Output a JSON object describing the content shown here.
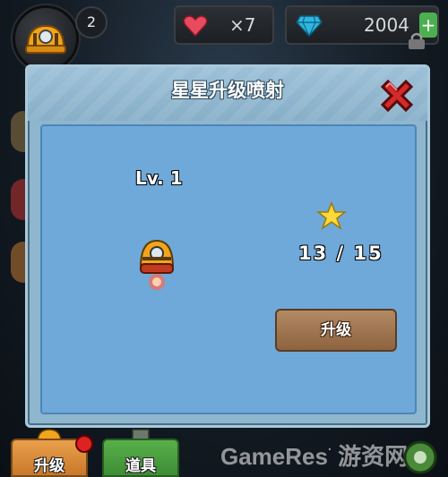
{
  "top_bar": {
    "level": "2",
    "lives": "×7",
    "gems": "2004",
    "plus": "+"
  },
  "modal": {
    "title": "星星升级喷射",
    "level_label": "Lv. 1",
    "star_progress": "13 / 15",
    "upgrade_button": "升级"
  },
  "bottom_tabs": {
    "upgrade": "升级",
    "items": "道具"
  },
  "watermark": "GameRes",
  "watermark_cn": "游资网",
  "colors": {
    "modal_bg": "#8fb6cf",
    "inner_bg": "#6fa9d9",
    "button_brown": "#9a6f49",
    "close_red": "#d42a2a"
  }
}
